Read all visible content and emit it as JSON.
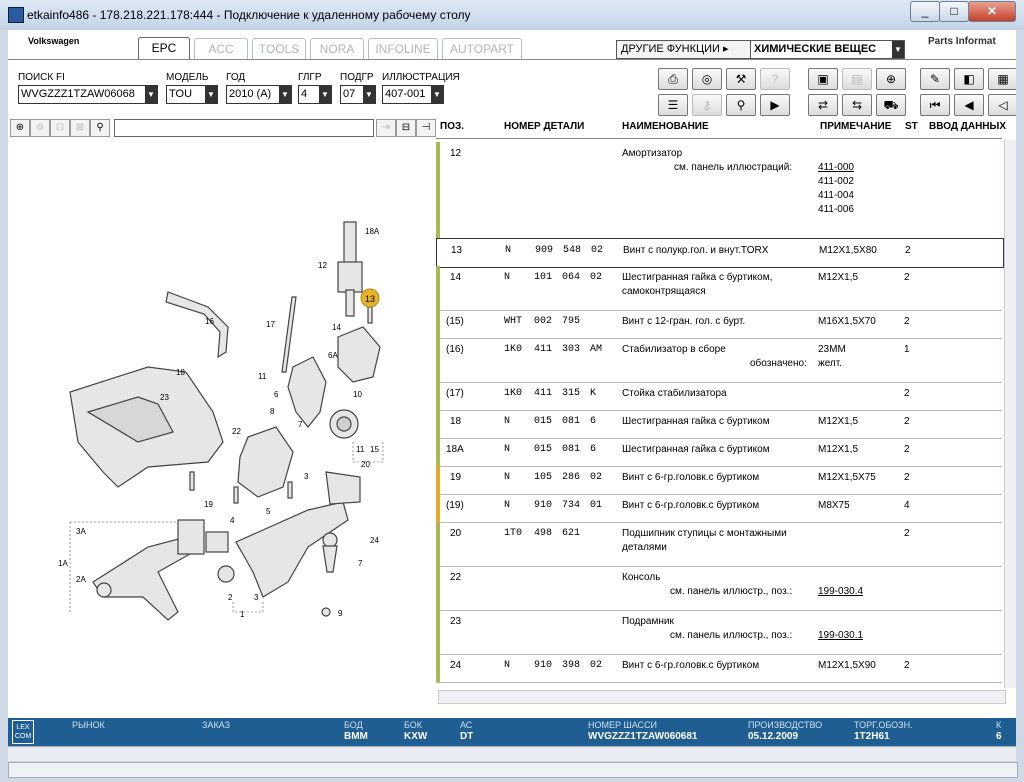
{
  "window": {
    "title": "etkainfo486 - 178.218.221.178:444 - Подключение к удаленному рабочему столу",
    "min": "_",
    "max": "□",
    "close": "✕"
  },
  "header": {
    "brand": "Volkswagen",
    "brand_right": "Parts Informat",
    "tabs": [
      "EPC",
      "ACC",
      "TOOLS",
      "NORA",
      "INFOLINE",
      "AUTOPART"
    ],
    "other_functions": "ДРУГИЕ ФУНКЦИИ ▸",
    "chem_select": "ХИМИЧЕСКИЕ ВЕЩЕС"
  },
  "filters": {
    "fi_label": "ПОИСК FI",
    "fi_value": "WVGZZZ1TZAW06068",
    "model_label": "МОДЕЛЬ",
    "model_value": "TOU",
    "year_label": "ГОД",
    "year_value": "2010 (A)",
    "glgr_label": "ГЛГР",
    "glgr_value": "4",
    "podgr_label": "ПОДГР",
    "podgr_value": "07",
    "illus_label": "ИЛЛЮСТРАЦИЯ",
    "illus_value": "407-001"
  },
  "table": {
    "headers": {
      "pos": "ПОЗ.",
      "part": "НОМЕР ДЕТАЛИ",
      "name": "НАИМЕНОВАНИЕ",
      "note": "ПРИМЕЧАНИЕ",
      "st": "ST",
      "input": "ВВОД ДАННЫХ"
    },
    "rows": [
      {
        "pos": "12",
        "p1": "",
        "p2": "",
        "p3": "",
        "p4": "",
        "name": "Амортизатор",
        "sub": "см. панель иллюстраций:",
        "notes": [
          "411-000",
          "411-002",
          "411-004",
          "411-006"
        ],
        "st": ""
      },
      {
        "pos": "13",
        "p1": "N",
        "p2": "909",
        "p3": "548",
        "p4": "02",
        "name": "Винт с полукр.гол. и внут.TORX",
        "note": "M12X1,5X80",
        "st": "2"
      },
      {
        "pos": "14",
        "p1": "N",
        "p2": "101",
        "p3": "064",
        "p4": "02",
        "name": "Шестигранная гайка с буртиком,",
        "name2": "самоконтрящаяся",
        "note": "M12X1,5",
        "st": "2"
      },
      {
        "pos": "(15)",
        "p1": "WHT",
        "p2": "002",
        "p3": "795",
        "p4": "",
        "name": "Винт с 12-гран. гол. с бурт.",
        "note": "M16X1,5X70",
        "st": "2"
      },
      {
        "pos": "(16)",
        "p1": "1K0",
        "p2": "411",
        "p3": "303",
        "p4": "AM",
        "name": "Стабилизатор в сборе",
        "sub": "обозначено:",
        "note": "23MM",
        "note2": "желт.",
        "st": "1"
      },
      {
        "pos": "(17)",
        "p1": "1K0",
        "p2": "411",
        "p3": "315",
        "p4": "K",
        "name": "Стойка стабилизатора",
        "note": "",
        "st": "2"
      },
      {
        "pos": "18",
        "p1": "N",
        "p2": "015",
        "p3": "081",
        "p4": "6",
        "name": "Шестигранная гайка с буртиком",
        "note": "M12X1,5",
        "st": "2"
      },
      {
        "pos": "18A",
        "p1": "N",
        "p2": "015",
        "p3": "081",
        "p4": "6",
        "name": "Шестигранная гайка с буртиком",
        "note": "M12X1,5",
        "st": "2"
      },
      {
        "pos": "19",
        "p1": "N",
        "p2": "105",
        "p3": "286",
        "p4": "02",
        "name": "Винт с 6-гр.головк.с буртиком",
        "note": "M12X1,5X75",
        "st": "2"
      },
      {
        "pos": "(19)",
        "p1": "N",
        "p2": "910",
        "p3": "734",
        "p4": "01",
        "name": "Винт с 6-гр.головк.с буртиком",
        "note": "M8X75",
        "st": "4"
      },
      {
        "pos": "20",
        "p1": "1T0",
        "p2": "498",
        "p3": "621",
        "p4": "",
        "name": "Подшипник ступицы с монтажными",
        "name2": "деталями",
        "note": "",
        "st": "2"
      },
      {
        "pos": "22",
        "p1": "",
        "p2": "",
        "p3": "",
        "p4": "",
        "name": "Консоль",
        "sub": "см. панель иллюстр., поз.:",
        "link": "199-030.4",
        "st": ""
      },
      {
        "pos": "23",
        "p1": "",
        "p2": "",
        "p3": "",
        "p4": "",
        "name": "Подрамник",
        "sub": "см. панель иллюстр., поз.:",
        "link": "199-030.1",
        "st": ""
      },
      {
        "pos": "24",
        "p1": "N",
        "p2": "910",
        "p3": "398",
        "p4": "02",
        "name": "Винт с 6-гр.головк.с буртиком",
        "note": "M12X1,5X90",
        "st": "2"
      }
    ]
  },
  "diagram_labels": [
    "18A",
    "12",
    "13",
    "16",
    "17",
    "14",
    "6A",
    "18",
    "11",
    "6",
    "10",
    "8",
    "23",
    "7",
    "22",
    "11",
    "15",
    "20",
    "3",
    "19",
    "4",
    "5",
    "24",
    "3A",
    "1A",
    "2A",
    "7",
    "2",
    "3",
    "1",
    "9"
  ],
  "status": {
    "lexcom": "LEX COM",
    "market_label": "РЫНОК",
    "market_value": "",
    "order_label": "ЗАКАЗ",
    "order_value": "",
    "bod_label": "БОД",
    "bod_value": "BMM",
    "bok_label": "БОК",
    "bok_value": "KXW",
    "ac_label": "АС",
    "ac_value": "DT",
    "chassis_label": "НОМЕР ШАССИ",
    "chassis_value": "WVGZZZ1TZAW060681",
    "prod_label": "ПРОИЗВОДСТВО",
    "prod_value": "05.12.2009",
    "torg_label": "ТОРГ.ОБОЗН.",
    "torg_value": "1T2H61",
    "k_label": "К",
    "k_value": "6"
  },
  "colors": {
    "status_bg": "#1f5e93",
    "row_bar": "#a9b95a",
    "row_bar_orange": "#e8a92a",
    "highlight_marker": "#e5b22a"
  }
}
